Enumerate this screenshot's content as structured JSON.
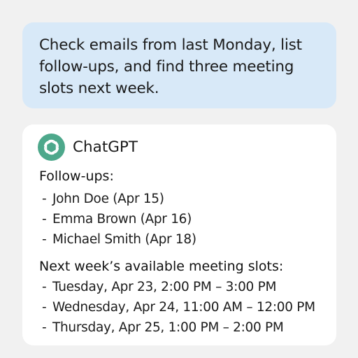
{
  "user_message": {
    "text": "Check emails from last Monday, list follow-ups, and find three meeting slots next week."
  },
  "assistant": {
    "name": "ChatGPT",
    "logo_icon": "openai-knot-icon",
    "logo_color": "#4da88b",
    "followups": {
      "heading": "Follow-ups:",
      "items": [
        {
          "marker": "-",
          "text": "John Doe (Apr 15)"
        },
        {
          "marker": "-",
          "text": "Emma Brown (Apr 16)"
        },
        {
          "marker": "-",
          "text": "Michael Smith (Apr 18)"
        }
      ]
    },
    "meeting_slots": {
      "heading": "Next week’s available meeting slots:",
      "items": [
        {
          "marker": "-",
          "text": "Tuesday, Apr 23, 2:00 PM – 3:00 PM"
        },
        {
          "marker": "-",
          "text": "Wednesday, Apr 24, 11:00 AM – 12:00 PM"
        },
        {
          "marker": "-",
          "text": "Thursday, Apr 25, 1:00 PM – 2:00 PM"
        }
      ]
    }
  },
  "colors": {
    "background": "#f1f1f1",
    "user_bubble": "#d8e9f8",
    "assistant_card": "#ffffff"
  }
}
